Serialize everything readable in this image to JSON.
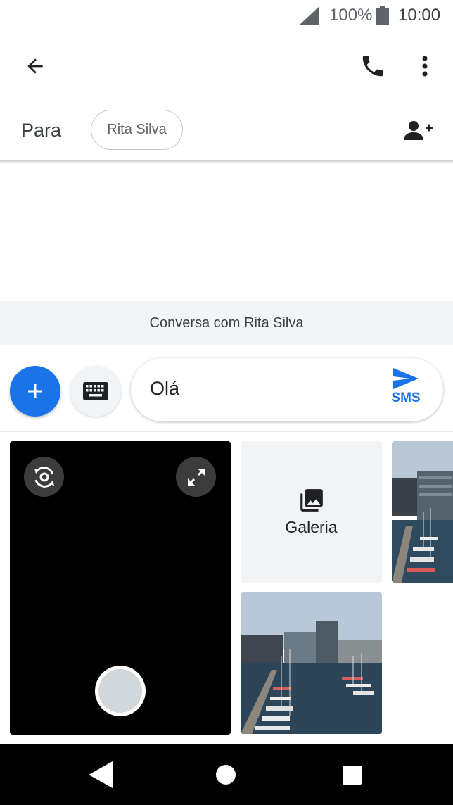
{
  "status_bar": {
    "battery_text": "100%",
    "time": "10:00",
    "signal_icon": "signal-icon",
    "battery_icon": "battery-icon"
  },
  "app_bar": {
    "back_icon": "arrow-back-icon",
    "call_icon": "phone-icon",
    "more_icon": "more-vert-icon"
  },
  "recipients": {
    "label": "Para",
    "chips": [
      {
        "name": "Rita Silva"
      }
    ],
    "add_icon": "add-person-icon"
  },
  "conversation": {
    "banner": "Conversa com Rita Silva"
  },
  "compose": {
    "text": "Olá",
    "send_label": "SMS",
    "attach_icon": "plus-icon",
    "keyboard_icon": "keyboard-icon",
    "send_icon": "send-icon"
  },
  "media_picker": {
    "gallery_label": "Galeria",
    "gallery_icon": "photo-library-icon",
    "camera_flip_icon": "switch-camera-icon",
    "camera_expand_icon": "fullscreen-icon"
  },
  "colors": {
    "accent": "#1a73e8",
    "banner_bg": "#f3f4f5",
    "camera_bg": "#000000"
  }
}
